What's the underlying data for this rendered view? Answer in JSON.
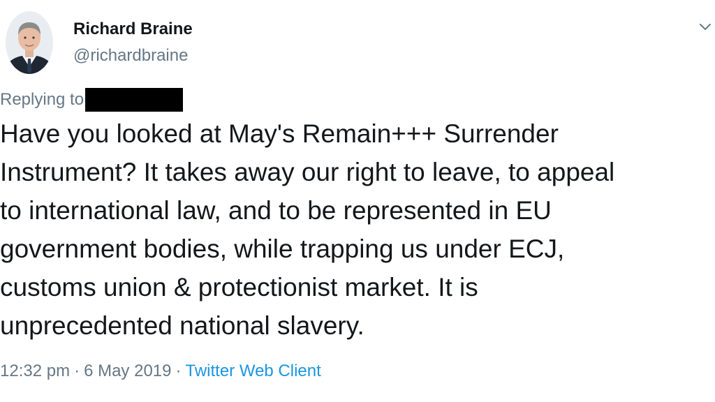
{
  "author": {
    "name": "Richard Braine",
    "handle": "@richardbraine"
  },
  "icons": {
    "avatar": "profile-photo-icon",
    "menu": "chevron-down-icon"
  },
  "reply": {
    "label": "Replying to"
  },
  "tweet": {
    "lines": [
      "Have you looked at May's Remain+++ Surrender",
      "Instrument? It takes away our right to leave, to appeal",
      "to international law, and to be represented in EU",
      "government bodies, while trapping us under ECJ,",
      "customs union & protectionist market. It is",
      "unprecedented national slavery."
    ]
  },
  "meta": {
    "time": "12:32 pm",
    "date": "6 May 2019",
    "separator": "·",
    "client": "Twitter Web Client"
  },
  "colors": {
    "text": "#14171a",
    "muted": "#657786",
    "link": "#1b95e0"
  }
}
